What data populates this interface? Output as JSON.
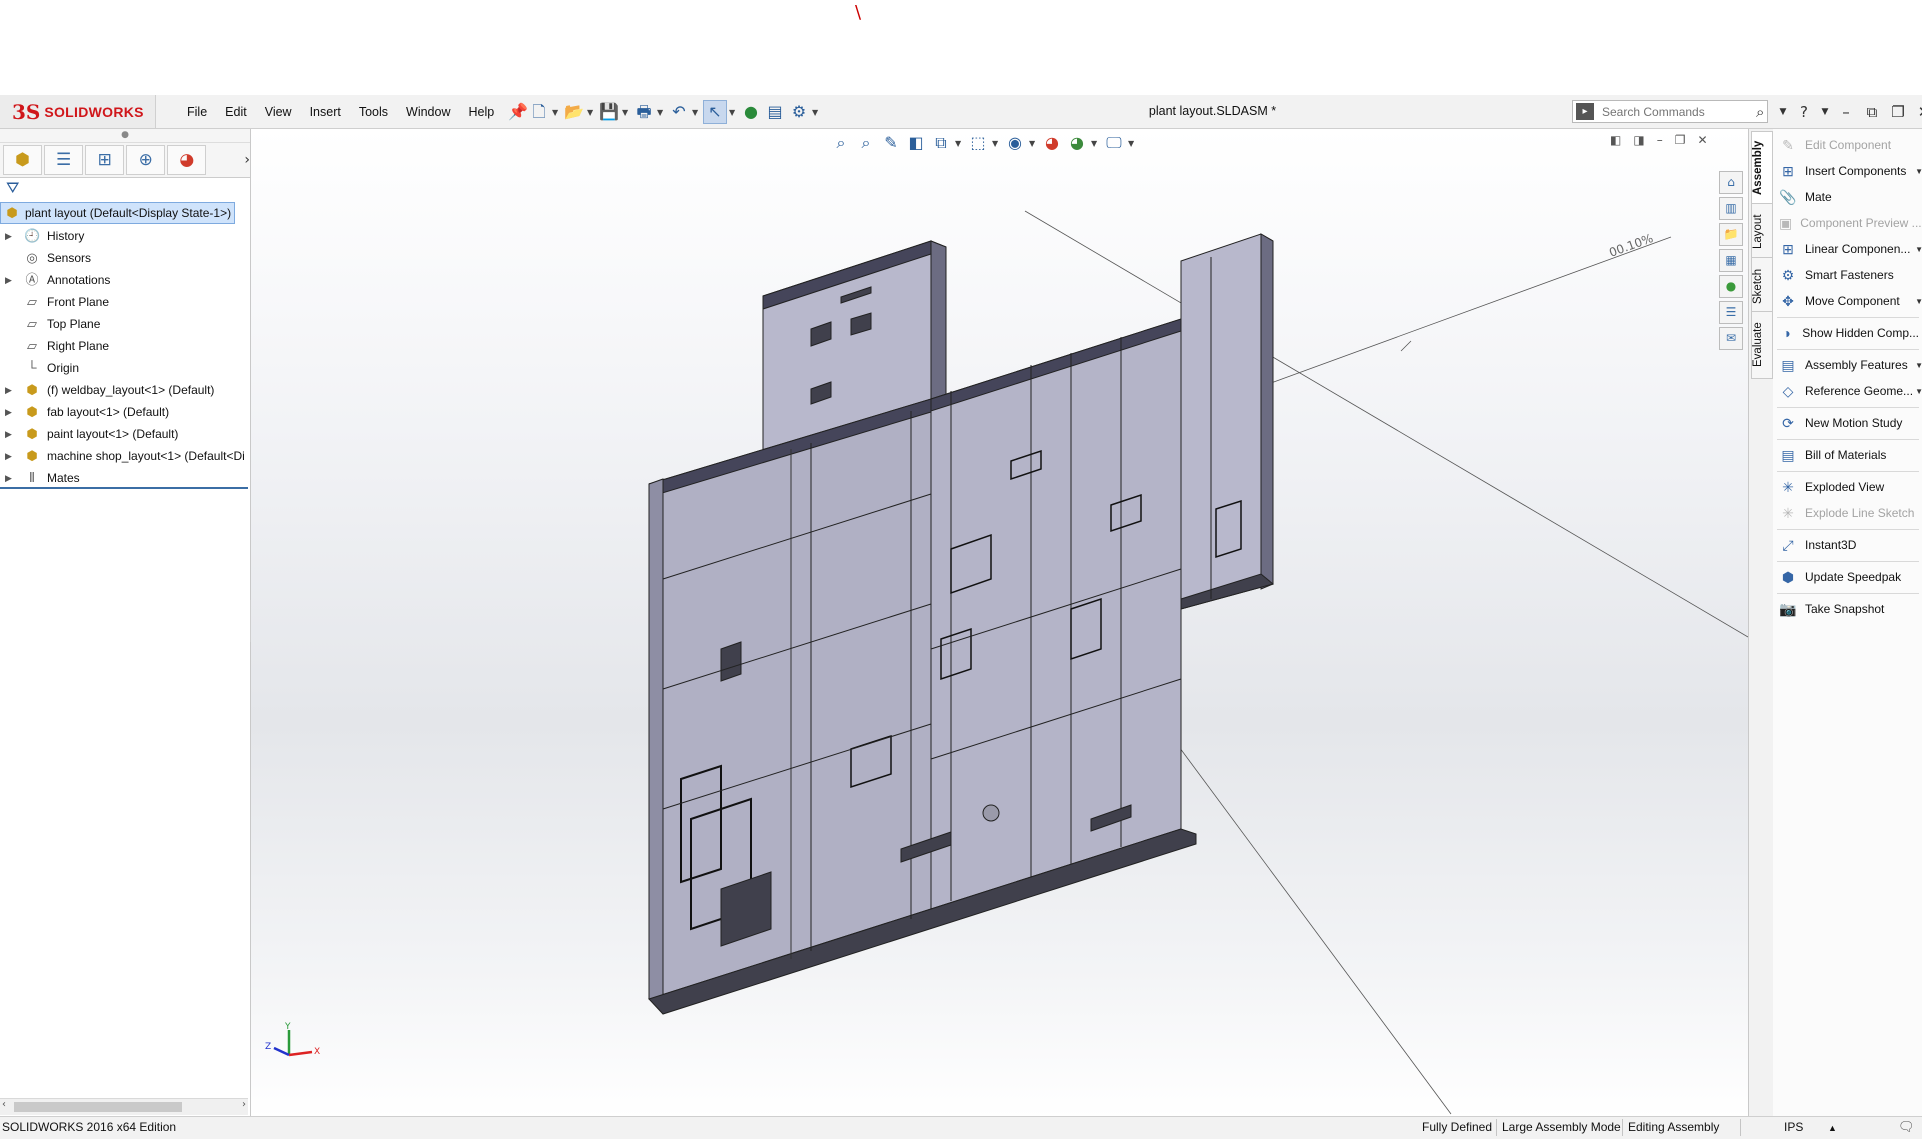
{
  "app": {
    "brand_ds": "3S",
    "brand_name": "SOLIDWORKS",
    "document_title": "plant layout.SLDASM *",
    "top_mark": "\\"
  },
  "menu": [
    "File",
    "Edit",
    "View",
    "Insert",
    "Tools",
    "Window",
    "Help"
  ],
  "search": {
    "placeholder": "Search Commands"
  },
  "feature_tree": {
    "root": "plant layout  (Default<Display State-1>)",
    "items": [
      {
        "label": "History",
        "expandable": true,
        "icon": "history-icon"
      },
      {
        "label": "Sensors",
        "expandable": false,
        "icon": "sensor-icon"
      },
      {
        "label": "Annotations",
        "expandable": true,
        "icon": "annotation-icon"
      },
      {
        "label": "Front Plane",
        "expandable": false,
        "icon": "plane-icon"
      },
      {
        "label": "Top Plane",
        "expandable": false,
        "icon": "plane-icon"
      },
      {
        "label": "Right Plane",
        "expandable": false,
        "icon": "plane-icon"
      },
      {
        "label": "Origin",
        "expandable": false,
        "icon": "origin-icon"
      },
      {
        "label": "(f) weldbay_layout<1> (Default)",
        "expandable": true,
        "icon": "subassembly-icon"
      },
      {
        "label": "fab layout<1> (Default)",
        "expandable": true,
        "icon": "subassembly-icon"
      },
      {
        "label": "paint layout<1> (Default)",
        "expandable": true,
        "icon": "subassembly-icon"
      },
      {
        "label": "machine shop_layout<1> (Default<Di",
        "expandable": true,
        "icon": "subassembly-icon"
      },
      {
        "label": "Mates",
        "expandable": true,
        "icon": "mates-icon"
      }
    ]
  },
  "viewport": {
    "dimension_label": "00.10%"
  },
  "command_manager": {
    "tabs": [
      "Assembly",
      "Layout",
      "Sketch",
      "Evaluate"
    ],
    "active_tab": "Assembly",
    "commands": [
      {
        "label": "Edit Component",
        "disabled": true,
        "dropdown": false
      },
      {
        "label": "Insert Components",
        "disabled": false,
        "dropdown": true
      },
      {
        "label": "Mate",
        "disabled": false,
        "dropdown": false
      },
      {
        "label": "Component Preview ...",
        "disabled": true,
        "dropdown": false
      },
      {
        "label": "Linear Componen...",
        "disabled": false,
        "dropdown": true
      },
      {
        "label": "Smart Fasteners",
        "disabled": false,
        "dropdown": false
      },
      {
        "label": "Move Component",
        "disabled": false,
        "dropdown": true
      },
      {
        "label": "Show Hidden Comp...",
        "disabled": false,
        "dropdown": false
      },
      {
        "label": "Assembly Features",
        "disabled": false,
        "dropdown": true
      },
      {
        "label": "Reference Geome...",
        "disabled": false,
        "dropdown": true
      },
      {
        "label": "New Motion Study",
        "disabled": false,
        "dropdown": false
      },
      {
        "label": "Bill of Materials",
        "disabled": false,
        "dropdown": false
      },
      {
        "label": "Exploded View",
        "disabled": false,
        "dropdown": false
      },
      {
        "label": "Explode Line Sketch",
        "disabled": true,
        "dropdown": false
      },
      {
        "label": "Instant3D",
        "disabled": false,
        "dropdown": false
      },
      {
        "label": "Update Speedpak",
        "disabled": false,
        "dropdown": false
      },
      {
        "label": "Take Snapshot",
        "disabled": false,
        "dropdown": false
      }
    ]
  },
  "status_bar": {
    "edition": "SOLIDWORKS 2016 x64 Edition",
    "definition": "Fully Defined",
    "mode": "Large Assembly Mode",
    "editing": "Editing Assembly",
    "units": "IPS"
  },
  "triad": {
    "x": "X",
    "y": "Y",
    "z": "Z"
  },
  "colors": {
    "brand_red": "#d0161a",
    "model_face": "#b4b4c8",
    "model_dark": "#40404c",
    "selection": "#cfe3fb"
  }
}
